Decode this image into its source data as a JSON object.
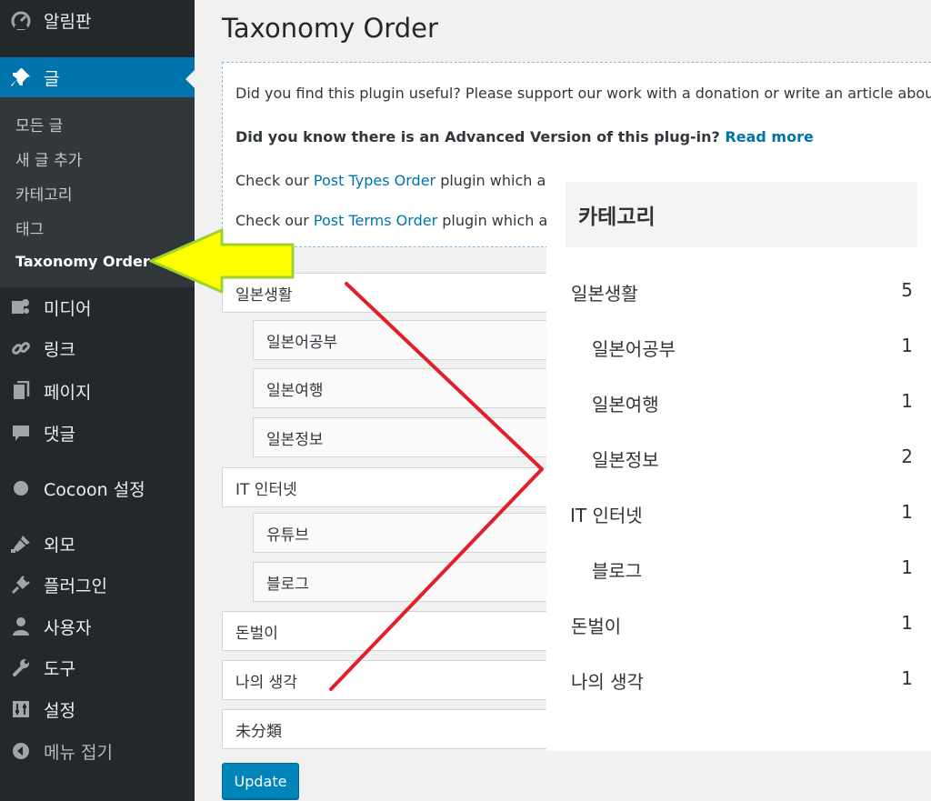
{
  "sidebar": {
    "dashboard": "알림판",
    "posts": "글",
    "submenu": [
      "모든 글",
      "새 글 추가",
      "카테고리",
      "태그",
      "Taxonomy Order"
    ],
    "media": "미디어",
    "links": "링크",
    "pages": "페이지",
    "comments": "댓글",
    "cocoon": "Cocoon 설정",
    "appearance": "외모",
    "plugins": "플러그인",
    "users": "사용자",
    "tools": "도구",
    "settings": "설정",
    "collapse": "메뉴 접기"
  },
  "main": {
    "title": "Taxonomy Order",
    "notice": {
      "line1": "Did you find this plugin useful? Please support our work with a donation or write an article about thi",
      "line2_prefix": "Did you know there is an Advanced Version of this plug-in?",
      "line2_link": "Read more",
      "line3_prefix": "Check our",
      "line3_link": "Post Types Order",
      "line3_suffix": "plugin which allo",
      "line4_prefix": "Check our",
      "line4_link": "Post Terms Order",
      "line4_suffix": "plugin which allo"
    },
    "terms": [
      "일본생활",
      "일본어공부",
      "일본여행",
      "일본정보",
      "IT 인터넷",
      "유튜브",
      "블로그",
      "돈벌이",
      "나의 생각",
      "未分類"
    ],
    "update_button": "Update"
  },
  "category_widget": {
    "title": "카테고리",
    "items": [
      {
        "name": "일본생활",
        "count": "5"
      },
      {
        "name": "일본어공부",
        "count": "1"
      },
      {
        "name": "일본여행",
        "count": "1"
      },
      {
        "name": "일본정보",
        "count": "2"
      },
      {
        "name": "IT 인터넷",
        "count": "1"
      },
      {
        "name": "블로그",
        "count": "1"
      },
      {
        "name": "돈벌이",
        "count": "1"
      },
      {
        "name": "나의 생각",
        "count": "1"
      }
    ]
  },
  "icons": {
    "dashboard": "dashboard-icon",
    "posts": "pushpin-icon",
    "media": "media-icon",
    "links": "link-icon",
    "pages": "pages-icon",
    "comments": "comment-icon",
    "cocoon": "circle-icon",
    "appearance": "brush-icon",
    "plugins": "plug-icon",
    "users": "user-icon",
    "tools": "wrench-icon",
    "settings": "sliders-icon",
    "collapse": "collapse-icon"
  },
  "colors": {
    "sidebar_bg": "#23282d",
    "submenu_bg": "#32373c",
    "accent": "#0073aa",
    "button": "#0085ba",
    "highlight_arrow": "#ffff00",
    "annotation_line": "#e0202a"
  }
}
